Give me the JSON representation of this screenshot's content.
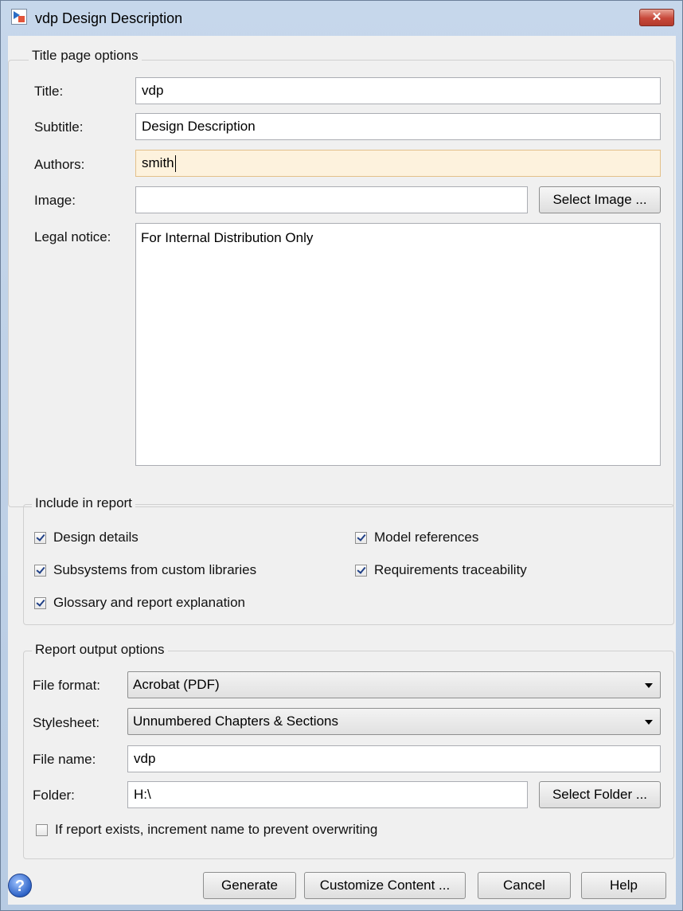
{
  "window": {
    "title": "vdp Design Description",
    "close_glyph": "✕"
  },
  "title_page": {
    "legend": "Title page options",
    "title_label": "Title:",
    "title_value": "vdp",
    "subtitle_label": "Subtitle:",
    "subtitle_value": "Design Description",
    "authors_label": "Authors:",
    "authors_value": "smith",
    "image_label": "Image:",
    "image_value": "",
    "select_image_label": "Select Image ...",
    "legal_label": "Legal notice:",
    "legal_value": "For Internal Distribution Only"
  },
  "include": {
    "legend": "Include in report",
    "options": [
      {
        "label": "Design details",
        "checked": true
      },
      {
        "label": "Model references",
        "checked": true
      },
      {
        "label": "Subsystems from custom libraries",
        "checked": true
      },
      {
        "label": "Requirements traceability",
        "checked": true
      },
      {
        "label": "Glossary and report explanation",
        "checked": true
      }
    ]
  },
  "output": {
    "legend": "Report output options",
    "file_format_label": "File format:",
    "file_format_value": "Acrobat (PDF)",
    "stylesheet_label": "Stylesheet:",
    "stylesheet_value": "Unnumbered Chapters & Sections",
    "file_name_label": "File name:",
    "file_name_value": "vdp",
    "folder_label": "Folder:",
    "folder_value": "H:\\",
    "select_folder_label": "Select Folder ...",
    "increment_label": "If report exists, increment name to prevent overwriting",
    "increment_checked": false
  },
  "footer": {
    "help_icon_glyph": "?",
    "generate_label": "Generate",
    "customize_label": "Customize Content ...",
    "cancel_label": "Cancel",
    "help_label": "Help"
  },
  "icons": {
    "app": "simulink-model-icon",
    "help": "help-icon",
    "close": "close-icon"
  }
}
